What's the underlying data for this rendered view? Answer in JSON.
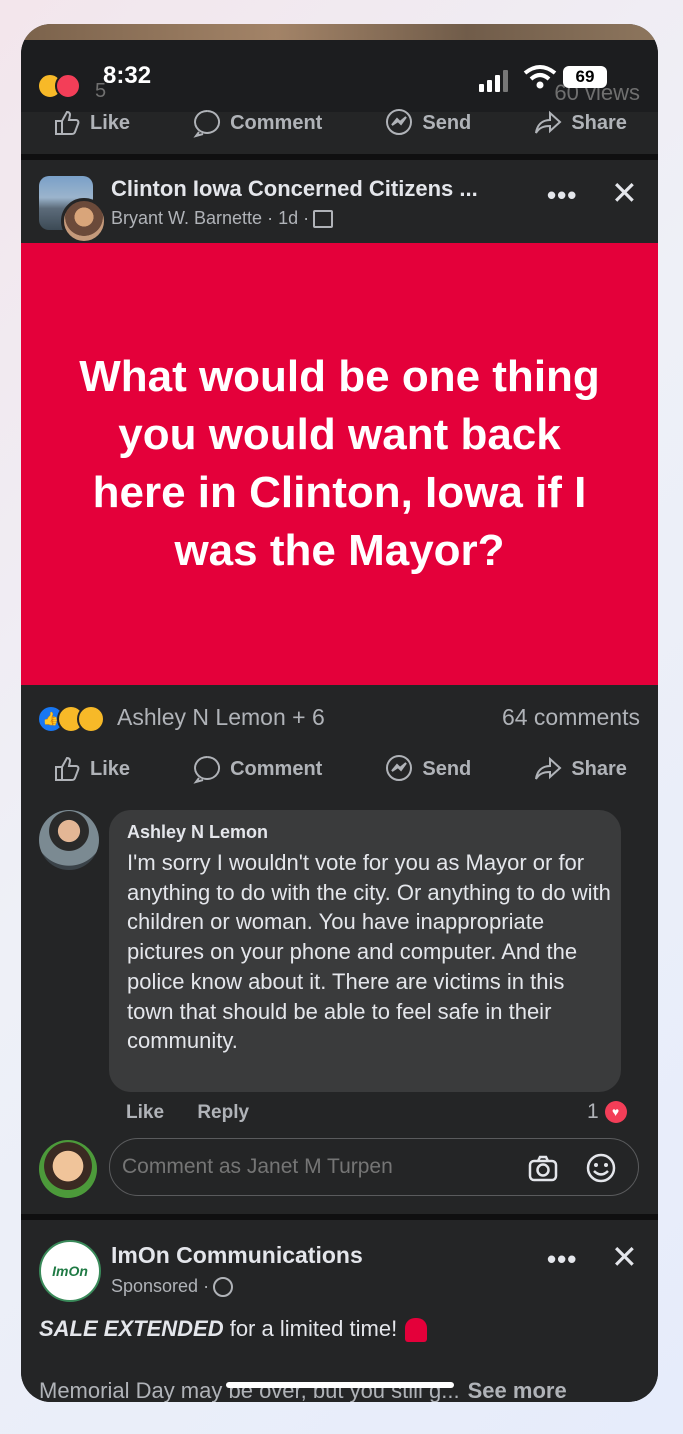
{
  "status": {
    "react_count": "5",
    "time": "8:32",
    "views": "60 views",
    "battery": "69"
  },
  "actions": {
    "like": "Like",
    "comment": "Comment",
    "send": "Send",
    "share": "Share"
  },
  "post": {
    "group": "Clinton Iowa Concerned Citizens ...",
    "author_meta": "Bryant W. Barnette · 1d ·",
    "card_text": "What would be one thing you would want back here in Clinton, Iowa if I was the Mayor?",
    "reactions_names": "Ashley N Lemon + 6",
    "comments_count": "64 comments"
  },
  "comment": {
    "author": "Ashley N Lemon",
    "text": "I'm sorry I wouldn't vote for you as Mayor or for anything to do with the city. Or anything to do with children or woman. You have inappropriate pictures on your phone and computer. And the police know about it. There are victims in this town that should be able to feel safe in their community.",
    "like": "Like",
    "reply": "Reply",
    "likes": "1"
  },
  "compose": {
    "placeholder": "Comment as Janet M Turpen"
  },
  "ad": {
    "name": "ImOn Communications",
    "sponsored": "Sponsored ·",
    "logo_text": "ImOn",
    "headline_bold": "SALE EXTENDED",
    "headline_rest": " for a limited time!",
    "body": "Memorial Day may be over, but you still g...",
    "see_more": "See more"
  }
}
